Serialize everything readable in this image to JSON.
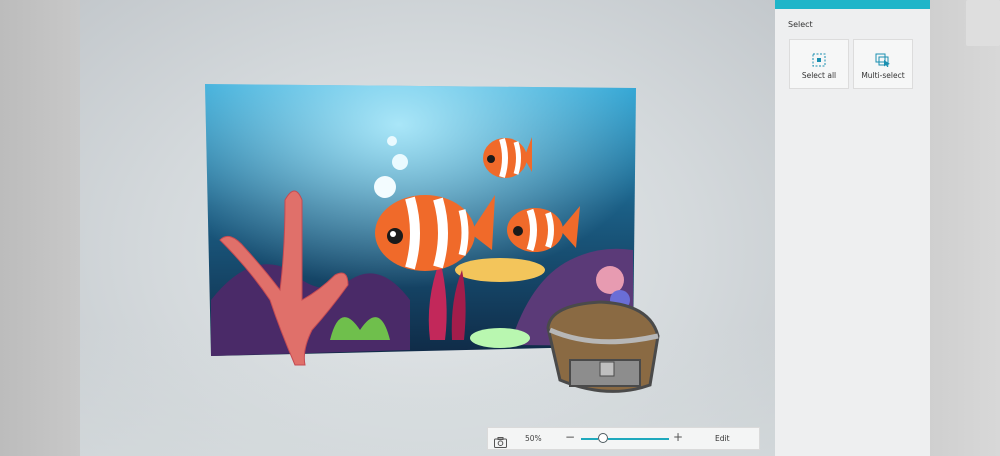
{
  "panel": {
    "title": "Select",
    "buttons": [
      {
        "label": "Select all",
        "icon": "select-all-icon"
      },
      {
        "label": "Multi-select",
        "icon": "multi-select-icon"
      }
    ]
  },
  "zoom": {
    "value_label": "50%",
    "level_fraction": 0.22,
    "minus": "−",
    "plus": "+",
    "edit_label": "Edit"
  },
  "colors": {
    "accent": "#1fb5c9",
    "panel_bg": "#eeeff0"
  }
}
